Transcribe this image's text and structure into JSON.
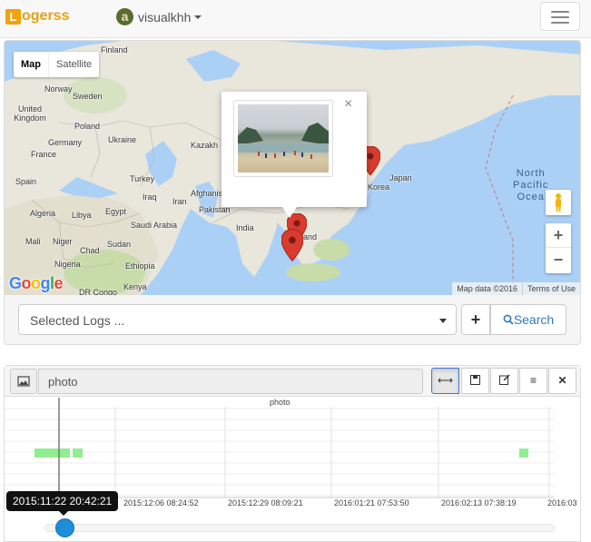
{
  "navbar": {
    "brand_initial": "L",
    "brand_text": "ogerss",
    "user_avatar_letter": "a",
    "user_name": "visualkhh"
  },
  "map": {
    "type_map": "Map",
    "type_satellite": "Satellite",
    "google_logo": "Google",
    "attribution": "Map data ©2016",
    "terms": "Terms of Use",
    "zoom_in": "+",
    "zoom_out": "−",
    "close_glyph": "×",
    "ocean_labels": [
      "North",
      "Pacific",
      "Ocea"
    ],
    "labels": [
      "Finland",
      "Norway",
      "Sweden",
      "United Kingdom",
      "Poland",
      "Germany",
      "Ukraine",
      "France",
      "Kazakh",
      "Turkey",
      "Spain",
      "Iraq",
      "Iran",
      "Afghanist",
      "Algeria",
      "Libya",
      "Egypt",
      "Saudi Arabia",
      "Pakistan",
      "India",
      "Mali",
      "Niger",
      "Chad",
      "Sudan",
      "Nigeria",
      "Ethiopia",
      "DR Congo",
      "Kenya",
      "Japan",
      "Korea",
      "and"
    ],
    "marker_color": "#d93b2f"
  },
  "search": {
    "placeholder": "Selected Logs ...",
    "add_label": "+",
    "search_label": "Search",
    "search_color": "#337ab7"
  },
  "timeline": {
    "name": "photo",
    "chart_title": "photo",
    "buttons": [
      "⟷",
      "💾",
      "✎",
      "≡",
      "✕"
    ],
    "tooltip": "2015:11:22 20:42:21"
  },
  "chart_data": {
    "type": "bar",
    "title": "photo",
    "x_tick_labels": [
      "2015:12:06 08:24:52",
      "2015:12:29 08:09:21",
      "2016:01:21 07:53:50",
      "2016:02:13 07:38:19",
      "2016:03"
    ],
    "series": [
      {
        "color": "#90ee90",
        "events": [
          "2015:11:11 – 2015:11:20",
          "2015:11:21 – 2015:11:23",
          "2016:02:23 – 2016:02:25"
        ]
      }
    ],
    "cursor": "2015:11:22 20:42:21",
    "grid": true,
    "legend": "none"
  }
}
